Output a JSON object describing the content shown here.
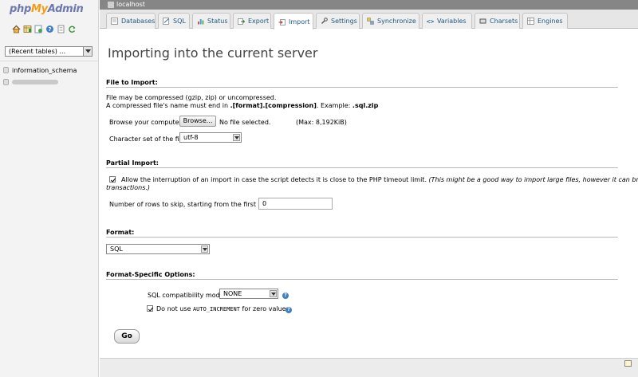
{
  "nav": {
    "logo": {
      "php": "php",
      "my": "My",
      "admin": "Admin"
    },
    "icons": [
      "home-icon",
      "table-icon",
      "query-icon",
      "help-icon",
      "docs-icon",
      "reload-icon"
    ],
    "recent_tables": "(Recent tables) ...",
    "databases": [
      "information_schema"
    ]
  },
  "serverbar": {
    "label": "localhost"
  },
  "tabs": [
    {
      "label": "Databases",
      "icon": "databases-icon"
    },
    {
      "label": "SQL",
      "icon": "sql-icon"
    },
    {
      "label": "Status",
      "icon": "status-icon"
    },
    {
      "label": "Export",
      "icon": "export-icon"
    },
    {
      "label": "Import",
      "icon": "import-icon",
      "active": true
    },
    {
      "label": "Settings",
      "icon": "settings-icon"
    },
    {
      "label": "Synchronize",
      "icon": "synchronize-icon"
    },
    {
      "label": "Variables",
      "icon": "variables-icon"
    },
    {
      "label": "Charsets",
      "icon": "charsets-icon"
    },
    {
      "label": "Engines",
      "icon": "engines-icon"
    }
  ],
  "main": {
    "title": "Importing into the current server",
    "file_section": {
      "heading": "File to Import:",
      "line1": "File may be compressed (gzip, zip) or uncompressed.",
      "line2_pre": "A compressed file's name must end in ",
      "line2_bold": ".[format].[compression]",
      "line2_mid": ". Example: ",
      "line2_example": ".sql.zip",
      "browse_label": "Browse your computer:",
      "browse_button": "Browse...",
      "no_file": "No file selected.",
      "max_size": "(Max: 8,192KiB)",
      "charset_label": "Character set of the file:",
      "charset_value": "utf-8"
    },
    "partial_section": {
      "heading": "Partial Import:",
      "allow_interrupt_checked": true,
      "allow_interrupt_label": "Allow the interruption of an import in case the script detects it is close to the PHP timeout limit.",
      "allow_interrupt_note_1": "(This might be a good way to import large files, however it can break",
      "allow_interrupt_note_2": "transactions.)",
      "skip_rows_label": "Number of rows to skip, starting from the first row:",
      "skip_rows_value": "0"
    },
    "format_section": {
      "heading": "Format:",
      "format_value": "SQL"
    },
    "options_section": {
      "heading": "Format-Specific Options:",
      "compat_label": "SQL compatibility mode:",
      "compat_value": "NONE",
      "no_auto_inc_checked": true,
      "no_auto_inc_pre": "Do not use ",
      "no_auto_inc_code": "AUTO_INCREMENT",
      "no_auto_inc_post": " for zero values"
    },
    "go_button": "Go"
  },
  "colors": {
    "accent_link": "#235a81",
    "serverbar_bg": "#868686",
    "nav_bg": "#f3f3f3"
  }
}
